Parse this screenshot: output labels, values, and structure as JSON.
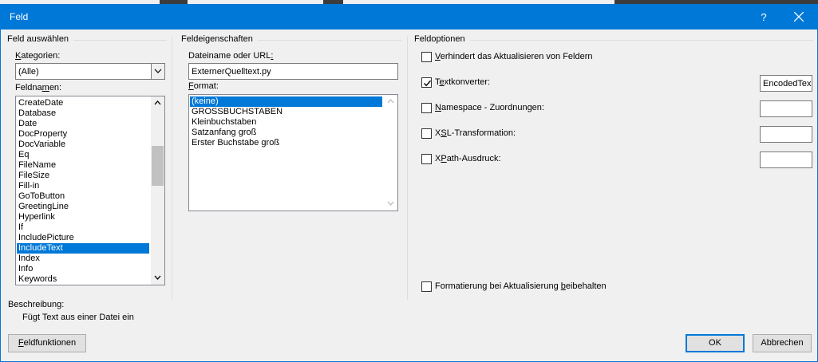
{
  "window": {
    "title": "Feld",
    "help_glyph": "?"
  },
  "select_field": {
    "group_title": "Feld auswählen",
    "categories_label": "Kategorien:",
    "categories_value": "(Alle)",
    "field_names_label": "Feldnamen:",
    "field_names": [
      "CreateDate",
      "Database",
      "Date",
      "DocProperty",
      "DocVariable",
      "Eq",
      "FileName",
      "FileSize",
      "Fill-in",
      "GoToButton",
      "GreetingLine",
      "Hyperlink",
      "If",
      "IncludePicture",
      "IncludeText",
      "Index",
      "Info",
      "Keywords"
    ],
    "selected_field": "IncludeText"
  },
  "properties": {
    "group_title": "Feldeigenschaften",
    "filename_label": "Dateiname oder URL:",
    "filename_value": "ExternerQuelltext.py",
    "format_label": "Format:",
    "formats": [
      "(keine)",
      "GROSSBUCHSTABEN",
      "Kleinbuchstaben",
      "Satzanfang groß",
      "Erster Buchstabe groß"
    ],
    "selected_format": "(keine)"
  },
  "options": {
    "group_title": "Feldoptionen",
    "items": [
      {
        "label": "Verhindert das Aktualisieren von Feldern",
        "checked": false,
        "value": null
      },
      {
        "label": "Textkonverter:",
        "checked": true,
        "value": "EncodedTex"
      },
      {
        "label": "Namespace - Zuordnungen:",
        "checked": false,
        "value": ""
      },
      {
        "label": "XSL-Transformation:",
        "checked": false,
        "value": ""
      },
      {
        "label": "XPath-Ausdruck:",
        "checked": false,
        "value": ""
      }
    ],
    "preserve_label": "Formatierung bei Aktualisierung beibehalten",
    "preserve_checked": false
  },
  "description": {
    "label": "Beschreibung:",
    "text": "Fügt Text aus einer Datei ein"
  },
  "buttons": {
    "field_codes": "Feldfunktionen",
    "ok": "OK",
    "cancel": "Abbrechen"
  },
  "colors": {
    "accent": "#0078d7",
    "dialog_bg": "#f0f0f0"
  }
}
